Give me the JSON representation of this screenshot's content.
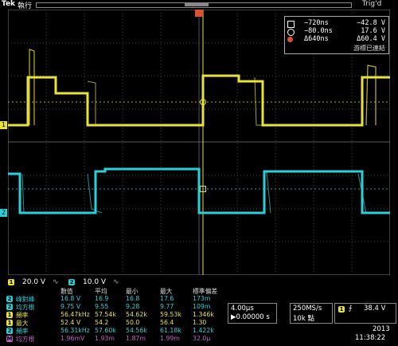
{
  "header": {
    "brand": "Tek",
    "status": "執行",
    "trigger_status": "Trig'd"
  },
  "channels": [
    {
      "id": "1",
      "color": "#e8e23a",
      "scale": "20.0 V"
    },
    {
      "id": "2",
      "color": "#2ad0d8",
      "scale": "10.0 V"
    }
  ],
  "cursor_readout": {
    "rows": [
      {
        "icon": "square-icon",
        "left": "−720ns",
        "right": "−42.8 V"
      },
      {
        "icon": "circle-icon",
        "left": "−80.0ns",
        "right": "17.6 V"
      },
      {
        "icon": "delta-icon",
        "left": "Δ640ns",
        "right": "Δ60.4 V"
      }
    ],
    "status": "游標已連結"
  },
  "measurements": {
    "headers": [
      "數值",
      "平均",
      "最小",
      "最大",
      "標準偏差"
    ],
    "rows": [
      {
        "ch": "2",
        "name": "峰對峰",
        "vals": [
          "16.8 V",
          "16.9",
          "16.8",
          "17.6",
          "173m"
        ]
      },
      {
        "ch": "2",
        "name": "均方根",
        "vals": [
          "9.75 V",
          "9.55",
          "9.28",
          "9.77",
          "109m"
        ]
      },
      {
        "ch": "1",
        "name": "頻率",
        "vals": [
          "56.47kHz",
          "57.54k",
          "54.62k",
          "59.53k",
          "1.346k"
        ]
      },
      {
        "ch": "1",
        "name": "最大",
        "vals": [
          "52.4 V",
          "54.2",
          "50.0",
          "56.4",
          "1.30"
        ]
      },
      {
        "ch": "2",
        "name": "頻率",
        "vals": [
          "56.31kHz",
          "57.60k",
          "54.56k",
          "61.18k",
          "1.422k"
        ]
      },
      {
        "ch": "M",
        "name": "均方根",
        "vals": [
          "1.96mV",
          "1.93m",
          "1.87m",
          "1.99m",
          "32.0μ"
        ]
      }
    ]
  },
  "horizontal": {
    "scale": "4.00μs",
    "position": "▶0.00000 s"
  },
  "acquisition": {
    "rate": "250MS/s",
    "record": "10k 點"
  },
  "trigger": {
    "channel": "1",
    "level": "38.4 V"
  },
  "datetime": {
    "date": "2013",
    "time": "11:38:22"
  }
}
